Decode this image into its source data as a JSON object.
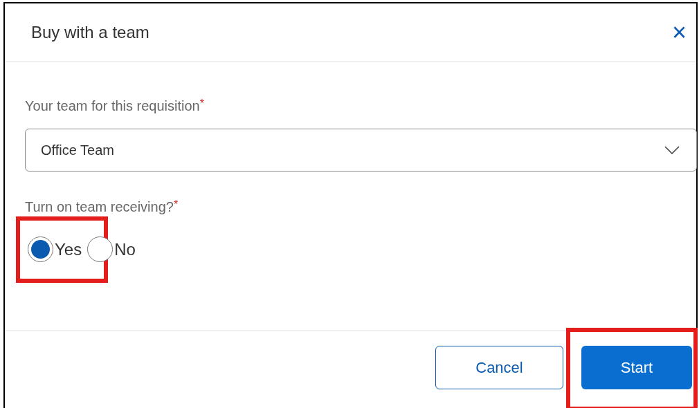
{
  "dialog": {
    "title": "Buy with a team",
    "close": "×"
  },
  "team_field": {
    "label": "Your team for this requisition",
    "required_mark": "*",
    "value": "Office Team"
  },
  "receiving": {
    "label": "Turn on team receiving?",
    "required_mark": "*",
    "options": [
      {
        "label": "Yes",
        "selected": true,
        "highlighted": true
      },
      {
        "label": "No",
        "selected": false,
        "highlighted": false
      }
    ]
  },
  "buttons": [
    {
      "label": "Cancel",
      "kind": "secondary",
      "highlighted": false
    },
    {
      "label": "Start",
      "kind": "primary",
      "highlighted": true
    }
  ]
}
